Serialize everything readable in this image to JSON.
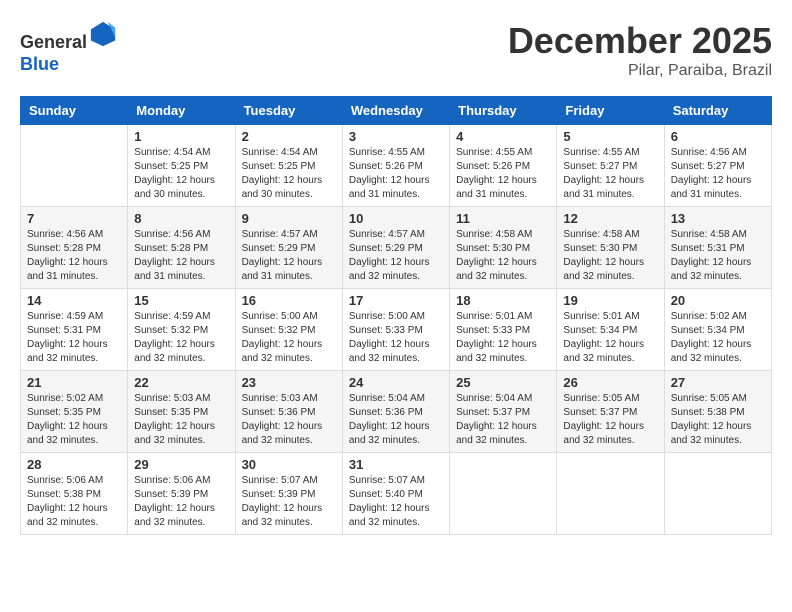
{
  "header": {
    "logo_line1": "General",
    "logo_line2": "Blue",
    "month": "December 2025",
    "location": "Pilar, Paraiba, Brazil"
  },
  "weekdays": [
    "Sunday",
    "Monday",
    "Tuesday",
    "Wednesday",
    "Thursday",
    "Friday",
    "Saturday"
  ],
  "weeks": [
    [
      {
        "day": "",
        "sunrise": "",
        "sunset": "",
        "daylight": ""
      },
      {
        "day": "1",
        "sunrise": "Sunrise: 4:54 AM",
        "sunset": "Sunset: 5:25 PM",
        "daylight": "Daylight: 12 hours and 30 minutes."
      },
      {
        "day": "2",
        "sunrise": "Sunrise: 4:54 AM",
        "sunset": "Sunset: 5:25 PM",
        "daylight": "Daylight: 12 hours and 30 minutes."
      },
      {
        "day": "3",
        "sunrise": "Sunrise: 4:55 AM",
        "sunset": "Sunset: 5:26 PM",
        "daylight": "Daylight: 12 hours and 31 minutes."
      },
      {
        "day": "4",
        "sunrise": "Sunrise: 4:55 AM",
        "sunset": "Sunset: 5:26 PM",
        "daylight": "Daylight: 12 hours and 31 minutes."
      },
      {
        "day": "5",
        "sunrise": "Sunrise: 4:55 AM",
        "sunset": "Sunset: 5:27 PM",
        "daylight": "Daylight: 12 hours and 31 minutes."
      },
      {
        "day": "6",
        "sunrise": "Sunrise: 4:56 AM",
        "sunset": "Sunset: 5:27 PM",
        "daylight": "Daylight: 12 hours and 31 minutes."
      }
    ],
    [
      {
        "day": "7",
        "sunrise": "Sunrise: 4:56 AM",
        "sunset": "Sunset: 5:28 PM",
        "daylight": "Daylight: 12 hours and 31 minutes."
      },
      {
        "day": "8",
        "sunrise": "Sunrise: 4:56 AM",
        "sunset": "Sunset: 5:28 PM",
        "daylight": "Daylight: 12 hours and 31 minutes."
      },
      {
        "day": "9",
        "sunrise": "Sunrise: 4:57 AM",
        "sunset": "Sunset: 5:29 PM",
        "daylight": "Daylight: 12 hours and 31 minutes."
      },
      {
        "day": "10",
        "sunrise": "Sunrise: 4:57 AM",
        "sunset": "Sunset: 5:29 PM",
        "daylight": "Daylight: 12 hours and 32 minutes."
      },
      {
        "day": "11",
        "sunrise": "Sunrise: 4:58 AM",
        "sunset": "Sunset: 5:30 PM",
        "daylight": "Daylight: 12 hours and 32 minutes."
      },
      {
        "day": "12",
        "sunrise": "Sunrise: 4:58 AM",
        "sunset": "Sunset: 5:30 PM",
        "daylight": "Daylight: 12 hours and 32 minutes."
      },
      {
        "day": "13",
        "sunrise": "Sunrise: 4:58 AM",
        "sunset": "Sunset: 5:31 PM",
        "daylight": "Daylight: 12 hours and 32 minutes."
      }
    ],
    [
      {
        "day": "14",
        "sunrise": "Sunrise: 4:59 AM",
        "sunset": "Sunset: 5:31 PM",
        "daylight": "Daylight: 12 hours and 32 minutes."
      },
      {
        "day": "15",
        "sunrise": "Sunrise: 4:59 AM",
        "sunset": "Sunset: 5:32 PM",
        "daylight": "Daylight: 12 hours and 32 minutes."
      },
      {
        "day": "16",
        "sunrise": "Sunrise: 5:00 AM",
        "sunset": "Sunset: 5:32 PM",
        "daylight": "Daylight: 12 hours and 32 minutes."
      },
      {
        "day": "17",
        "sunrise": "Sunrise: 5:00 AM",
        "sunset": "Sunset: 5:33 PM",
        "daylight": "Daylight: 12 hours and 32 minutes."
      },
      {
        "day": "18",
        "sunrise": "Sunrise: 5:01 AM",
        "sunset": "Sunset: 5:33 PM",
        "daylight": "Daylight: 12 hours and 32 minutes."
      },
      {
        "day": "19",
        "sunrise": "Sunrise: 5:01 AM",
        "sunset": "Sunset: 5:34 PM",
        "daylight": "Daylight: 12 hours and 32 minutes."
      },
      {
        "day": "20",
        "sunrise": "Sunrise: 5:02 AM",
        "sunset": "Sunset: 5:34 PM",
        "daylight": "Daylight: 12 hours and 32 minutes."
      }
    ],
    [
      {
        "day": "21",
        "sunrise": "Sunrise: 5:02 AM",
        "sunset": "Sunset: 5:35 PM",
        "daylight": "Daylight: 12 hours and 32 minutes."
      },
      {
        "day": "22",
        "sunrise": "Sunrise: 5:03 AM",
        "sunset": "Sunset: 5:35 PM",
        "daylight": "Daylight: 12 hours and 32 minutes."
      },
      {
        "day": "23",
        "sunrise": "Sunrise: 5:03 AM",
        "sunset": "Sunset: 5:36 PM",
        "daylight": "Daylight: 12 hours and 32 minutes."
      },
      {
        "day": "24",
        "sunrise": "Sunrise: 5:04 AM",
        "sunset": "Sunset: 5:36 PM",
        "daylight": "Daylight: 12 hours and 32 minutes."
      },
      {
        "day": "25",
        "sunrise": "Sunrise: 5:04 AM",
        "sunset": "Sunset: 5:37 PM",
        "daylight": "Daylight: 12 hours and 32 minutes."
      },
      {
        "day": "26",
        "sunrise": "Sunrise: 5:05 AM",
        "sunset": "Sunset: 5:37 PM",
        "daylight": "Daylight: 12 hours and 32 minutes."
      },
      {
        "day": "27",
        "sunrise": "Sunrise: 5:05 AM",
        "sunset": "Sunset: 5:38 PM",
        "daylight": "Daylight: 12 hours and 32 minutes."
      }
    ],
    [
      {
        "day": "28",
        "sunrise": "Sunrise: 5:06 AM",
        "sunset": "Sunset: 5:38 PM",
        "daylight": "Daylight: 12 hours and 32 minutes."
      },
      {
        "day": "29",
        "sunrise": "Sunrise: 5:06 AM",
        "sunset": "Sunset: 5:39 PM",
        "daylight": "Daylight: 12 hours and 32 minutes."
      },
      {
        "day": "30",
        "sunrise": "Sunrise: 5:07 AM",
        "sunset": "Sunset: 5:39 PM",
        "daylight": "Daylight: 12 hours and 32 minutes."
      },
      {
        "day": "31",
        "sunrise": "Sunrise: 5:07 AM",
        "sunset": "Sunset: 5:40 PM",
        "daylight": "Daylight: 12 hours and 32 minutes."
      },
      {
        "day": "",
        "sunrise": "",
        "sunset": "",
        "daylight": ""
      },
      {
        "day": "",
        "sunrise": "",
        "sunset": "",
        "daylight": ""
      },
      {
        "day": "",
        "sunrise": "",
        "sunset": "",
        "daylight": ""
      }
    ]
  ]
}
